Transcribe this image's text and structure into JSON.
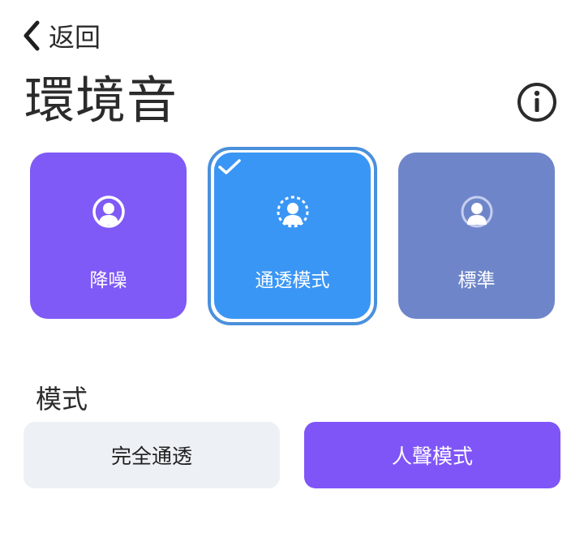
{
  "header": {
    "back_label": "返回",
    "title": "環境音",
    "icons": {
      "back": "chevron-left-icon",
      "info": "info-icon"
    }
  },
  "modes": [
    {
      "label": "降噪",
      "icon": "noise-cancel-person-icon",
      "color": "#7f5af6",
      "selected": false
    },
    {
      "label": "通透模式",
      "icon": "transparency-person-icon",
      "color": "#3a96f5",
      "selected": true
    },
    {
      "label": "標準",
      "icon": "standard-person-icon",
      "color": "#6e86c9",
      "selected": false
    }
  ],
  "selection_indicator": {
    "icon": "checkmark-icon",
    "ring_color": "#4a90dc"
  },
  "mode_section": {
    "label": "模式",
    "options": [
      {
        "label": "完全通透",
        "selected": false,
        "color": "#edf1f6"
      },
      {
        "label": "人聲模式",
        "selected": true,
        "color": "#7f55f7"
      }
    ]
  }
}
